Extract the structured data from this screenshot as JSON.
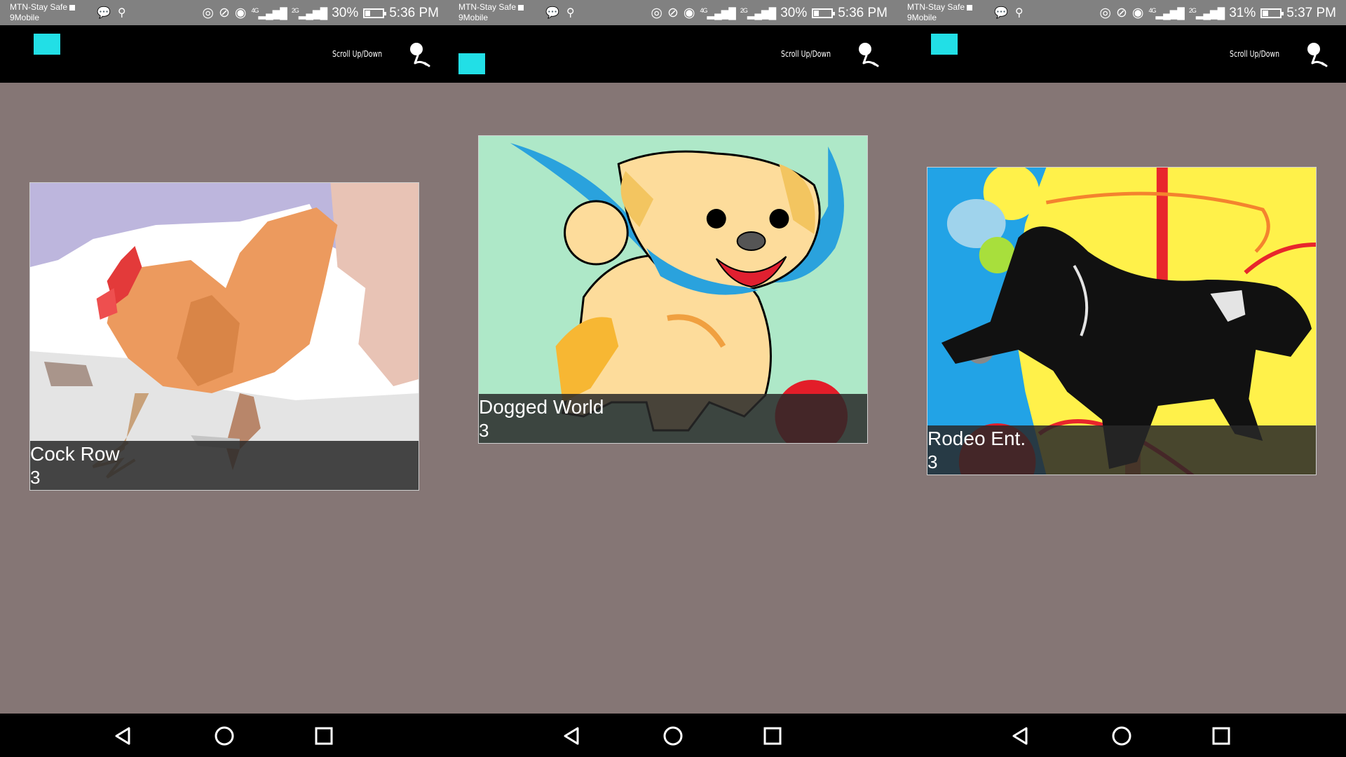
{
  "colors": {
    "accent": "#22dfe6",
    "background": "#857675",
    "status_bar": "#818181",
    "app_bar": "#000000"
  },
  "screens": [
    {
      "status": {
        "carrier1": "MTN-Stay Safe",
        "carrier2": "9Mobile",
        "net1": "4G",
        "net2": "2G",
        "battery": "30%",
        "battery_level": 0.3,
        "time": "5:36 PM"
      },
      "toolbar": {
        "scroll_label": "Scroll Up/Down"
      },
      "card": {
        "title": "Cock Row",
        "count": "3",
        "art": "rooster-illustration"
      }
    },
    {
      "status": {
        "carrier1": "MTN-Stay Safe",
        "carrier2": "9Mobile",
        "net1": "4G",
        "net2": "2G",
        "battery": "30%",
        "battery_level": 0.3,
        "time": "5:36 PM"
      },
      "toolbar": {
        "scroll_label": "Scroll Up/Down"
      },
      "card": {
        "title": "Dogged World",
        "count": "3",
        "art": "dog-illustration"
      }
    },
    {
      "status": {
        "carrier1": "MTN-Stay Safe",
        "carrier2": "9Mobile",
        "net1": "4G",
        "net2": "2G",
        "battery": "31%",
        "battery_level": 0.31,
        "time": "5:37 PM"
      },
      "toolbar": {
        "scroll_label": "Scroll Up/Down"
      },
      "card": {
        "title": "Rodeo Ent.",
        "count": "3",
        "art": "bull-illustration"
      }
    }
  ],
  "icons": {
    "search": "search-icon",
    "back": "back-triangle-icon",
    "home": "home-circle-icon",
    "recents": "recents-square-icon"
  }
}
